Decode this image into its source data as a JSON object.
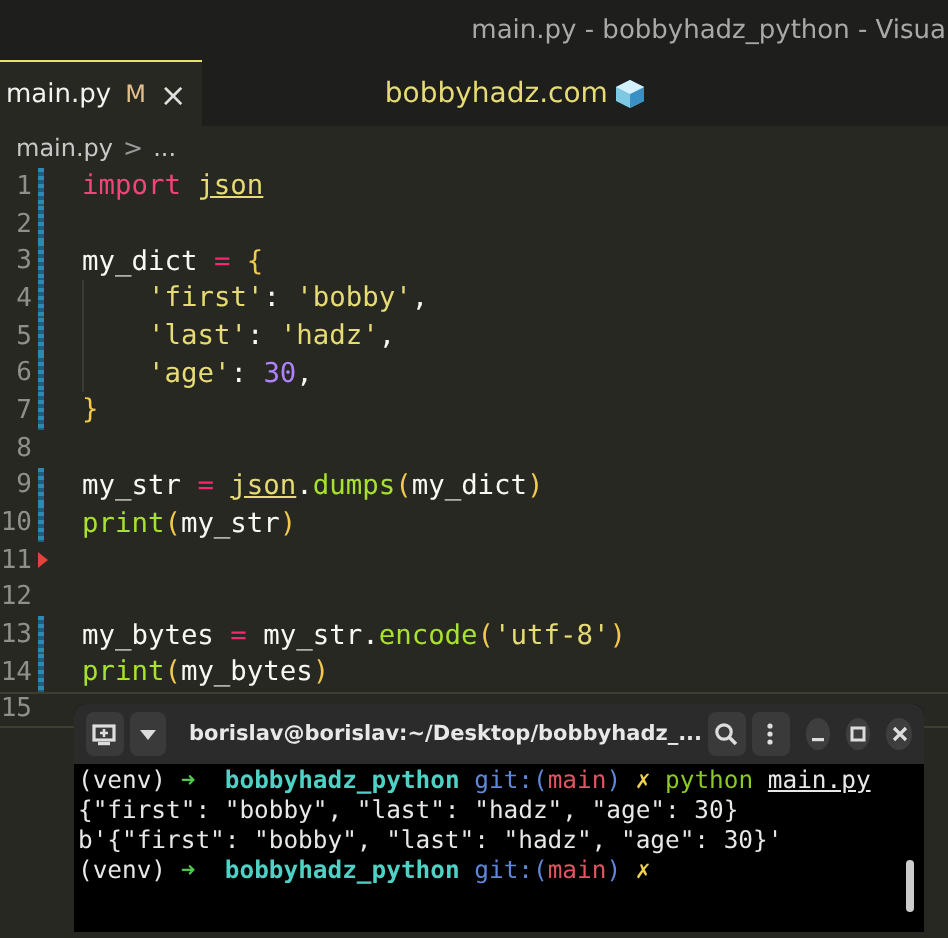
{
  "window": {
    "title": "main.py - bobbyhadz_python - Visua"
  },
  "tabs": [
    {
      "label": "main.py",
      "badge": "M",
      "close": "×",
      "selected": true
    }
  ],
  "banner": {
    "text": "bobbyhadz.com"
  },
  "breadcrumb": {
    "file": "main.py",
    "sep": ">",
    "rest": "..."
  },
  "editor": {
    "lines": [
      {
        "number": "1",
        "added": true,
        "deleted": false,
        "current": false,
        "indent": false,
        "tokens": [
          {
            "text": "import ",
            "kind": "keyword"
          },
          {
            "text": "json",
            "kind": "module"
          }
        ]
      },
      {
        "number": "2",
        "added": true,
        "deleted": false,
        "current": false,
        "indent": false
      },
      {
        "number": "3",
        "added": true,
        "deleted": false,
        "current": false,
        "indent": false,
        "tokens": [
          {
            "text": "my_dict ",
            "kind": "plain"
          },
          {
            "text": "= ",
            "kind": "operator"
          },
          {
            "text": "{",
            "kind": "bracket"
          }
        ]
      },
      {
        "number": "4",
        "added": true,
        "deleted": false,
        "current": false,
        "indent": true,
        "tokens": [
          {
            "text": "'first'",
            "kind": "string"
          },
          {
            "text": ": ",
            "kind": "plain"
          },
          {
            "text": "'bobby'",
            "kind": "string"
          },
          {
            "text": ",",
            "kind": "plain"
          }
        ]
      },
      {
        "number": "5",
        "added": true,
        "deleted": false,
        "current": false,
        "indent": true,
        "tokens": [
          {
            "text": "'last'",
            "kind": "string"
          },
          {
            "text": ": ",
            "kind": "plain"
          },
          {
            "text": "'hadz'",
            "kind": "string"
          },
          {
            "text": ",",
            "kind": "plain"
          }
        ]
      },
      {
        "number": "6",
        "added": true,
        "deleted": false,
        "current": false,
        "indent": true,
        "tokens": [
          {
            "text": "'age'",
            "kind": "string"
          },
          {
            "text": ": ",
            "kind": "plain"
          },
          {
            "text": "30",
            "kind": "number"
          },
          {
            "text": ",",
            "kind": "plain"
          }
        ]
      },
      {
        "number": "7",
        "added": true,
        "deleted": false,
        "current": false,
        "indent": false,
        "tokens": [
          {
            "text": "}",
            "kind": "bracket"
          }
        ]
      },
      {
        "number": "8",
        "added": false,
        "deleted": false,
        "current": false,
        "indent": false
      },
      {
        "number": "9",
        "added": true,
        "deleted": false,
        "current": false,
        "indent": false,
        "tokens": [
          {
            "text": "my_str ",
            "kind": "plain"
          },
          {
            "text": "= ",
            "kind": "operator"
          },
          {
            "text": "json",
            "kind": "module"
          },
          {
            "text": ".",
            "kind": "plain"
          },
          {
            "text": "dumps",
            "kind": "func"
          },
          {
            "text": "(",
            "kind": "bracket"
          },
          {
            "text": "my_dict",
            "kind": "plain"
          },
          {
            "text": ")",
            "kind": "bracket"
          }
        ]
      },
      {
        "number": "10",
        "added": true,
        "deleted": false,
        "current": false,
        "indent": false,
        "tokens": [
          {
            "text": "print",
            "kind": "func"
          },
          {
            "text": "(",
            "kind": "bracket"
          },
          {
            "text": "my_str",
            "kind": "plain"
          },
          {
            "text": ")",
            "kind": "bracket"
          }
        ]
      },
      {
        "number": "11",
        "added": false,
        "deleted": true,
        "current": false,
        "indent": false
      },
      {
        "number": "12",
        "added": false,
        "deleted": false,
        "current": false,
        "indent": false
      },
      {
        "number": "13",
        "added": true,
        "deleted": false,
        "current": false,
        "indent": false,
        "tokens": [
          {
            "text": "my_bytes ",
            "kind": "plain"
          },
          {
            "text": "= ",
            "kind": "operator"
          },
          {
            "text": "my_str.",
            "kind": "plain"
          },
          {
            "text": "encode",
            "kind": "func"
          },
          {
            "text": "(",
            "kind": "bracket"
          },
          {
            "text": "'utf-8'",
            "kind": "string"
          },
          {
            "text": ")",
            "kind": "bracket"
          }
        ]
      },
      {
        "number": "14",
        "added": true,
        "deleted": false,
        "current": false,
        "indent": false,
        "tokens": [
          {
            "text": "print",
            "kind": "func"
          },
          {
            "text": "(",
            "kind": "bracket"
          },
          {
            "text": "my_bytes",
            "kind": "plain"
          },
          {
            "text": ")",
            "kind": "bracket"
          }
        ]
      },
      {
        "number": "15",
        "added": false,
        "deleted": false,
        "current": true,
        "indent": false
      }
    ]
  },
  "terminal": {
    "title": "borislav@borislav:~/Desktop/bobbyhadz_...",
    "lines": [
      [
        {
          "text": "(venv) ",
          "kind": "plain"
        },
        {
          "text": "➜",
          "kind": "arrow"
        },
        {
          "text": "  bobbyhadz_python ",
          "kind": "dir"
        },
        {
          "text": "git:(",
          "kind": "git"
        },
        {
          "text": "main",
          "kind": "branch"
        },
        {
          "text": ")",
          "kind": "git"
        },
        {
          "text": " ✗ ",
          "kind": "dirty"
        },
        {
          "text": "python ",
          "kind": "command"
        },
        {
          "text": "main.py",
          "kind": "argument"
        }
      ],
      [
        {
          "text": "{\"first\": \"bobby\", \"last\": \"hadz\", \"age\": 30}",
          "kind": "plain"
        }
      ],
      [
        {
          "text": "b'{\"first\": \"bobby\", \"last\": \"hadz\", \"age\": 30}'",
          "kind": "plain"
        }
      ],
      [
        {
          "text": "(venv) ",
          "kind": "plain"
        },
        {
          "text": "➜",
          "kind": "arrow"
        },
        {
          "text": "  bobbyhadz_python ",
          "kind": "dir"
        },
        {
          "text": "git:(",
          "kind": "git"
        },
        {
          "text": "main",
          "kind": "branch"
        },
        {
          "text": ")",
          "kind": "git"
        },
        {
          "text": " ✗",
          "kind": "dirty"
        }
      ]
    ]
  }
}
